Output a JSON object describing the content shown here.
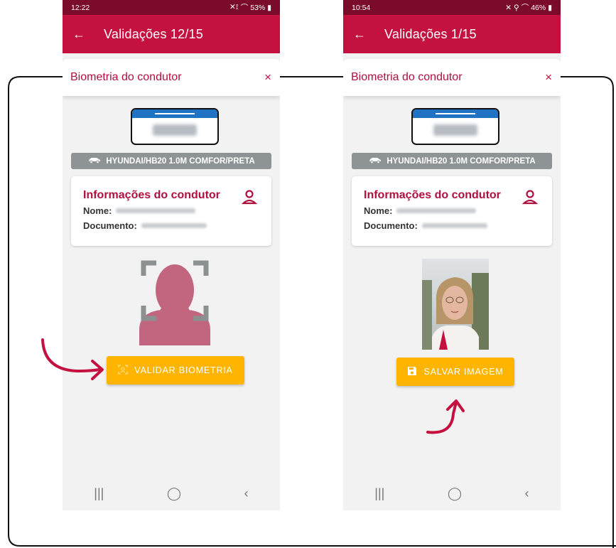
{
  "left_phone": {
    "status": {
      "time": "12:22",
      "battery": "53%"
    },
    "appbar": {
      "title": "Validações 12/15"
    },
    "sheet": {
      "title": "Biometria do condutor",
      "close": "×"
    },
    "vehicle": "HYUNDAI/HB20 1.0M COMFOR/PRETA",
    "driver": {
      "card_title": "Informações do condutor",
      "name_label": "Nome:",
      "document_label": "Documento:"
    },
    "button": {
      "label": "VALIDAR BIOMETRIA"
    }
  },
  "right_phone": {
    "status": {
      "time": "10:54",
      "battery": "46%"
    },
    "appbar": {
      "title": "Validações 1/15"
    },
    "sheet": {
      "title": "Biometria do condutor",
      "close": "×"
    },
    "vehicle": "HYUNDAI/HB20 1.0M COMFOR/PRETA",
    "driver": {
      "card_title": "Informações do condutor",
      "name_label": "Nome:",
      "document_label": "Documento:"
    },
    "button": {
      "label": "SALVAR IMAGEM"
    }
  },
  "navbar": {
    "recent": "|||",
    "home": "◯",
    "back": "‹"
  },
  "colors": {
    "primary": "#c4113f",
    "status": "#7a0b2b",
    "accent": "#ffb400",
    "plate_blue": "#1f73c2",
    "avatar": "#c26680"
  },
  "icons": [
    "back-arrow-icon",
    "close-icon",
    "car-icon",
    "user-icon",
    "face-scan-icon",
    "save-icon",
    "wifi-icon",
    "signal-icon",
    "battery-icon"
  ]
}
